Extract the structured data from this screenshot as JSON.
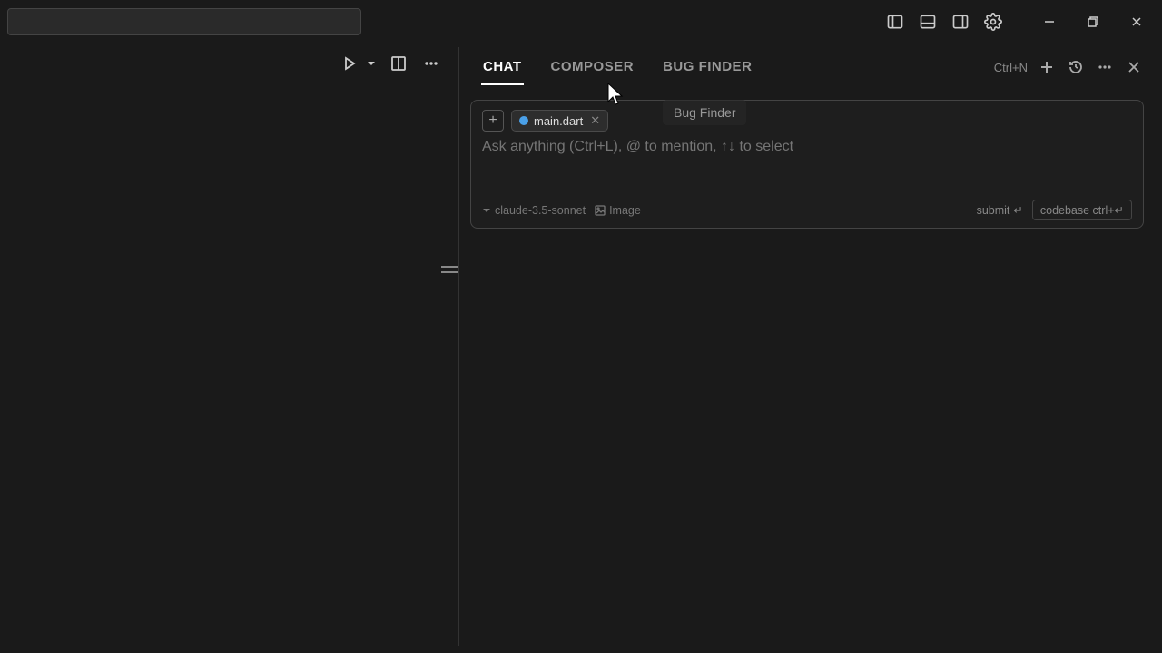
{
  "titlebar": {
    "minimize": "—",
    "restore": "❐",
    "close": "✕"
  },
  "panel": {
    "tabs": [
      "CHAT",
      "COMPOSER",
      "BUG FINDER"
    ],
    "active_tab": 0,
    "shortcut": "Ctrl+N",
    "tooltip": "Bug Finder"
  },
  "input": {
    "file_chip": "main.dart",
    "placeholder": "Ask anything (Ctrl+L), @ to mention, ↑↓ to select",
    "model": "claude-3.5-sonnet",
    "image_label": "Image",
    "submit_label": "submit",
    "submit_icon": "↵",
    "codebase_label": "codebase ctrl+↵"
  }
}
